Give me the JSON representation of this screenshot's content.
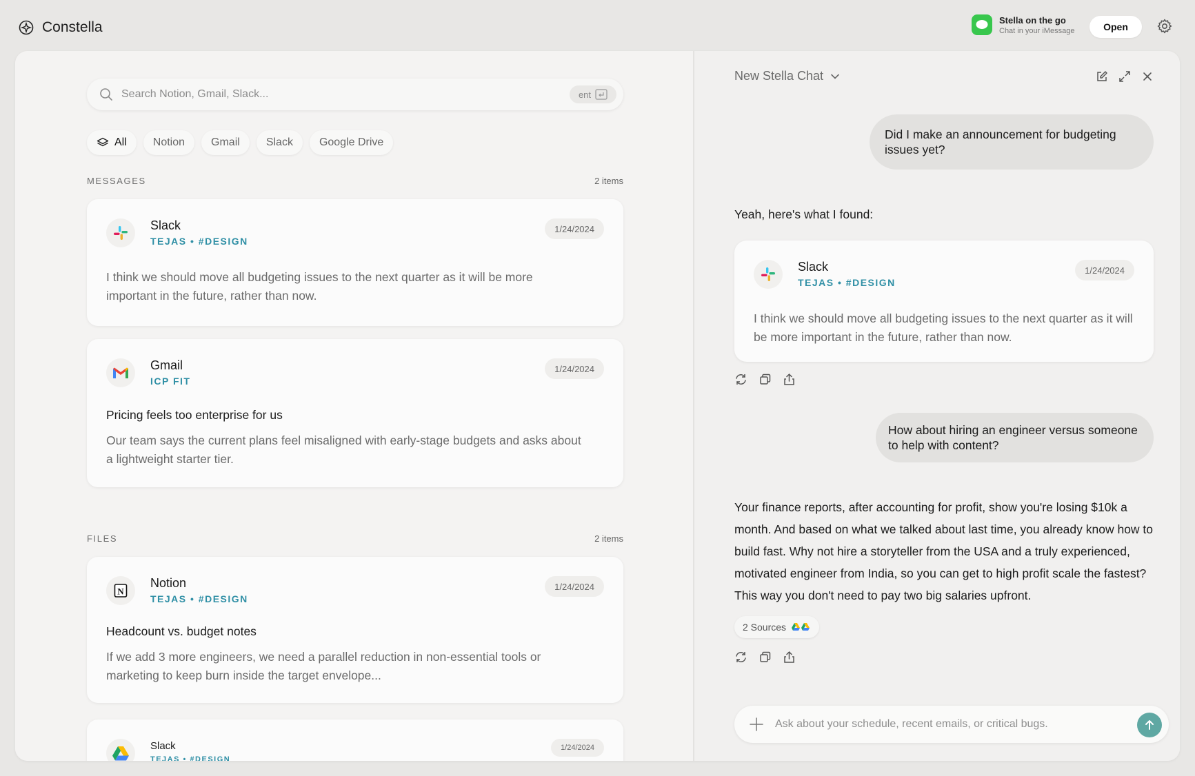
{
  "app": {
    "name": "Constella"
  },
  "promo": {
    "title": "Stella on the go",
    "subtitle": "Chat in your iMessage",
    "open_label": "Open"
  },
  "search": {
    "placeholder": "Search Notion, Gmail, Slack...",
    "shortcut": "ent"
  },
  "filters": [
    "All",
    "Notion",
    "Gmail",
    "Slack",
    "Google Drive"
  ],
  "messages": {
    "label": "MESSAGES",
    "count": "2 items",
    "items": [
      {
        "source": "Slack",
        "meta": "TEJAS • #DESIGN",
        "date": "1/24/2024",
        "body": "I think we should move all budgeting issues to the next quarter as it will be more important in the future, rather than now."
      },
      {
        "source": "Gmail",
        "meta": "ICP FIT",
        "date": "1/24/2024",
        "title": "Pricing feels too enterprise for us",
        "body": "Our team says the current plans feel misaligned with early-stage budgets and asks about a lightweight starter tier."
      }
    ]
  },
  "files": {
    "label": "FILES",
    "count": "2 items",
    "items": [
      {
        "source": "Notion",
        "meta": "TEJAS • #DESIGN",
        "date": "1/24/2024",
        "title": "Headcount vs. budget notes",
        "body": "If we add 3 more engineers, we need a parallel reduction in non-essential tools or marketing to keep burn inside the target envelope..."
      },
      {
        "source": "Slack",
        "meta": "TEJAS • #DESIGN",
        "date": "1/24/2024"
      }
    ]
  },
  "chat": {
    "title": "New Stella Chat",
    "q1": "Did I make an announcement for budgeting issues yet?",
    "a1_intro": "Yeah, here's what I found:",
    "a1_card": {
      "source": "Slack",
      "meta": "TEJAS • #DESIGN",
      "date": "1/24/2024",
      "body": "I think we should move all budgeting issues to the next quarter as it will be more important in the future, rather than now."
    },
    "q2": "How about hiring an engineer versus someone to help with content?",
    "a2": "Your finance reports, after accounting for profit, show you're losing $10k a month. And based on what we talked about last time, you already know how to build fast. Why not hire a storyteller from the USA and a truly experienced, motivated engineer from India, so you can get to high profit scale the fastest? This way you don't need to pay two big salaries upfront.",
    "sources_label": "2 Sources",
    "composer_placeholder": "Ask about your schedule, recent emails, or critical bugs."
  },
  "colors": {
    "accent": "#2f8fa5",
    "send": "#5fa8a3",
    "imessage": "#38c74d"
  }
}
